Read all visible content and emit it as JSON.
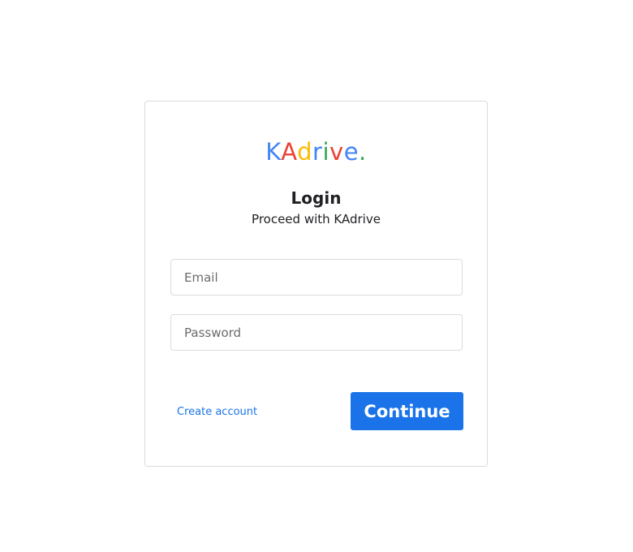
{
  "logo": {
    "letters": [
      {
        "char": "K",
        "color": "#4285f4"
      },
      {
        "char": "A",
        "color": "#ea4335"
      },
      {
        "char": "d",
        "color": "#fbbc05"
      },
      {
        "char": "r",
        "color": "#4285f4"
      },
      {
        "char": "i",
        "color": "#34a853"
      },
      {
        "char": "v",
        "color": "#ea4335"
      },
      {
        "char": "e",
        "color": "#4285f4"
      },
      {
        "char": ".",
        "color": "#34a853"
      }
    ]
  },
  "heading": {
    "title": "Login",
    "subtitle": "Proceed with KAdrive"
  },
  "form": {
    "email_placeholder": "Email",
    "email_value": "",
    "password_placeholder": "Password",
    "password_value": ""
  },
  "actions": {
    "create_account_label": "Create account",
    "continue_label": "Continue"
  },
  "colors": {
    "accent": "#1a73e8",
    "border": "#dadce0"
  }
}
